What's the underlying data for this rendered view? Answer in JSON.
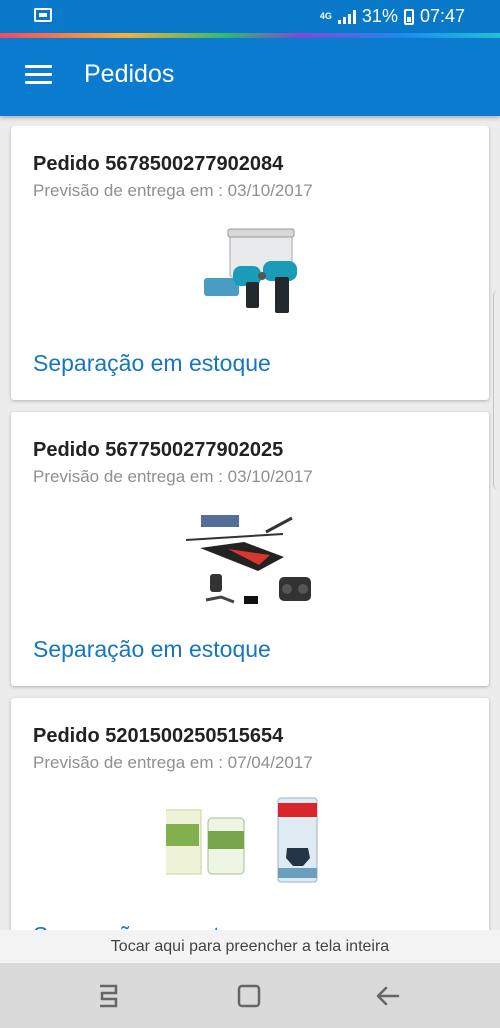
{
  "status_bar": {
    "network": "4G",
    "battery": "31%",
    "time": "07:47"
  },
  "app_bar": {
    "title": "Pedidos"
  },
  "orders": [
    {
      "title": "Pedido 5678500277902084",
      "delivery": "Previsão de entrega em : 03/10/2017",
      "status": "Separação em estoque",
      "image": "drill-kit"
    },
    {
      "title": "Pedido 5677500277902025",
      "delivery": "Previsão de entrega em : 03/10/2017",
      "status": "Separação em estoque",
      "image": "rc-helicopter"
    },
    {
      "title": "Pedido 5201500250515654",
      "delivery": "Previsão de entrega em : 07/04/2017",
      "status": "Separação em estoque",
      "image": "pet-supplements"
    }
  ],
  "fill_tip": "Tocar aqui para preencher a tela inteira",
  "navigation": {
    "recent": "recent-apps-icon",
    "home": "home-icon",
    "back": "back-icon"
  }
}
